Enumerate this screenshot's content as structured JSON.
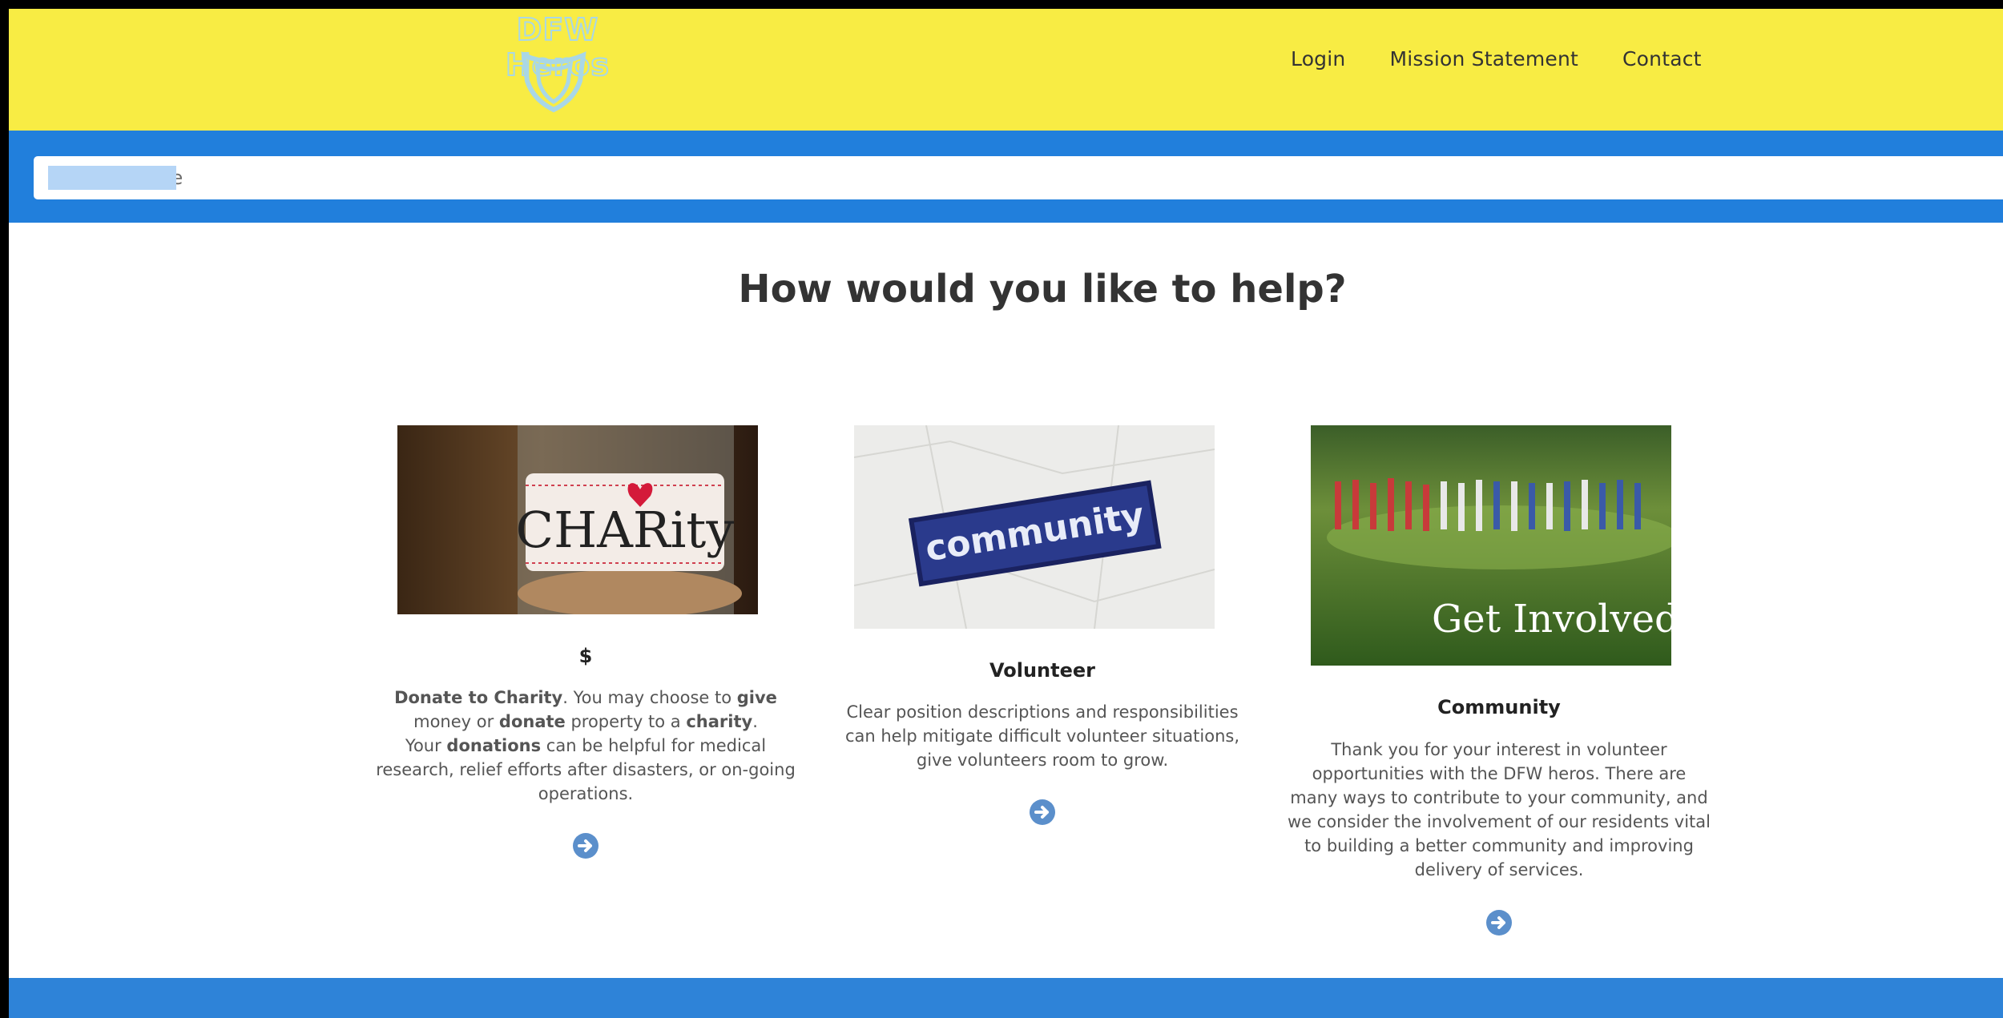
{
  "header": {
    "logo_text": "DFW Heros",
    "nav": [
      "Login",
      "Mission Statement",
      "Contact"
    ]
  },
  "search": {
    "placeholder": "Enter Zipcode"
  },
  "main": {
    "headline": "How would you like to help?",
    "cards": [
      {
        "image_label": "CHARity",
        "title": "$",
        "desc_parts": [
          {
            "b": "Donate to Charity"
          },
          {
            "t": ". You may choose to "
          },
          {
            "b": "give"
          },
          {
            "t": " money or "
          },
          {
            "b": "donate"
          },
          {
            "t": " property to a "
          },
          {
            "b": "charity"
          },
          {
            "t": "."
          },
          {
            "br": true
          },
          {
            "t": "Your "
          },
          {
            "b": "donations"
          },
          {
            "t": " can be helpful for medical research, relief efforts after disasters, or on-going operations."
          }
        ]
      },
      {
        "image_label": "community",
        "title": "Volunteer",
        "desc": "Clear position descriptions and responsibilities can help mitigate difficult volunteer situations, give volunteers room to grow."
      },
      {
        "image_label": "Get Involved!",
        "title": "Community",
        "desc": "Thank you for your interest in volunteer opportunities with the DFW heros. There are many ways to contribute to your community, and we consider the involvement of our residents vital to building a better community and improving delivery of services."
      }
    ]
  },
  "colors": {
    "header_bg": "#f8ec44",
    "band_blue": "#217fdc",
    "arrow_blue": "#5b8fcb"
  }
}
